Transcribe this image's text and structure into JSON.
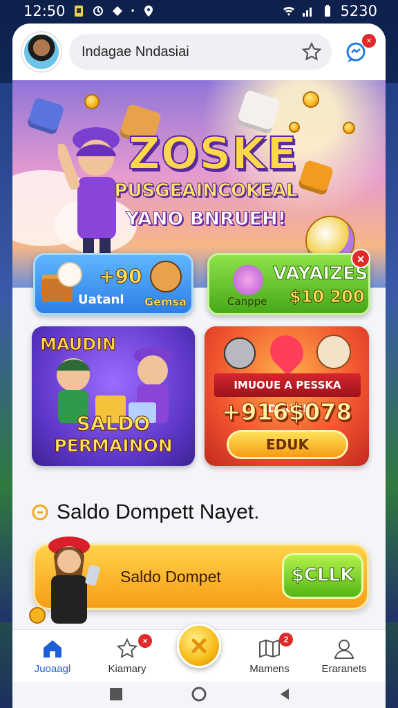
{
  "status_bar": {
    "time": "12:50",
    "battery_text": "5230"
  },
  "header": {
    "search_text": "Indagae Nndasiai",
    "chat_badge": "×"
  },
  "hero": {
    "title": "ZOSKE",
    "subtitle_line1": "PUSGEAINCOKEAL",
    "subtitle_line2": "YANO BNRUEH!"
  },
  "promos": {
    "blue": {
      "value": "+90",
      "label_left": "Uatanl",
      "label_right": "Gemsa"
    },
    "green": {
      "title": "VAYAIZES",
      "label": "Canppe",
      "value": "$10 200",
      "close": "×"
    }
  },
  "cards": {
    "left": {
      "title_top": "MAUDIN",
      "title_bottom_1": "SALDO",
      "title_bottom_2": "PERMAINON"
    },
    "right": {
      "ribbon": "IMUOUE A PESSKA DOUN!",
      "amount": "+916$078",
      "button": "EDUK"
    }
  },
  "section": {
    "heading": "Saldo Dompett Nayet."
  },
  "wallet": {
    "label": "Saldo Dompet",
    "button": "$CLLK"
  },
  "nav": {
    "items": [
      {
        "label": "Juoaagl",
        "icon": "home-icon"
      },
      {
        "label": "Kiamary",
        "icon": "star-icon",
        "badge": "×"
      },
      {
        "label": "",
        "icon": "coin-icon"
      },
      {
        "label": "Mamens",
        "icon": "map-icon",
        "badge": "2"
      },
      {
        "label": "Eraranets",
        "icon": "profile-icon"
      }
    ]
  },
  "colors": {
    "accent": "#1f5ed8",
    "badge": "#e02a2a",
    "wallet": "#f79d16",
    "cta": "#55b516"
  }
}
